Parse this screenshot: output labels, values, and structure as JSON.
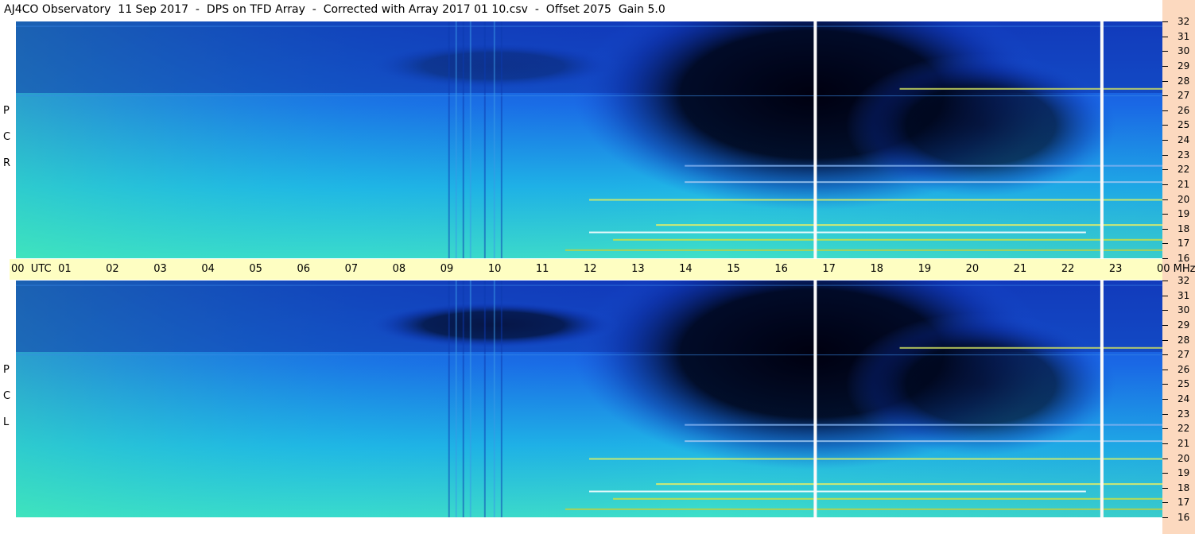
{
  "title": "AJ4CO Observatory  11 Sep 2017  -  DPS on TFD Array  -  Corrected with Array 2017 01 10.csv  -  Offset 2075  Gain 5.0",
  "time_axis": {
    "labels": [
      "00  UTC",
      "01",
      "02",
      "03",
      "04",
      "05",
      "06",
      "07",
      "08",
      "09",
      "10",
      "11",
      "12",
      "13",
      "14",
      "15",
      "16",
      "17",
      "18",
      "19",
      "20",
      "21",
      "22",
      "23",
      "00 MHz"
    ]
  },
  "freq_axis": {
    "labels": [
      "32",
      "31",
      "30",
      "29",
      "28",
      "27",
      "26",
      "25",
      "24",
      "23",
      "22",
      "21",
      "20",
      "19",
      "18",
      "17",
      "16"
    ]
  },
  "panels": {
    "top_label": [
      "R",
      "C",
      "P"
    ],
    "bottom_label": [
      "L",
      "C",
      "P"
    ]
  },
  "colors": {
    "background": "#ffffff",
    "time_strip": "#fefec2",
    "right_strip": "#fcd9bf",
    "low": "#000000",
    "mid": "#1a5ae0",
    "high": "#26c8d8",
    "peak": "#e8f040"
  },
  "chart_data": {
    "type": "heatmap",
    "title": "AJ4CO Observatory  11 Sep 2017  -  DPS on TFD Array  -  Corrected with Array 2017 01 10.csv  -  Offset 2075  Gain 5.0",
    "xlabel": "UTC",
    "ylabel": "MHz",
    "xlim": [
      0,
      24
    ],
    "ylim": [
      16,
      32
    ],
    "series": [
      {
        "name": "RCP"
      },
      {
        "name": "LCP"
      }
    ],
    "data_gaps_utc": [
      16.7,
      22.7
    ],
    "features": {
      "absorption_core_utc": [
        14,
        18
      ],
      "absorption_core_mhz": [
        23,
        29
      ],
      "interference_band_mhz": 17.8
    }
  }
}
